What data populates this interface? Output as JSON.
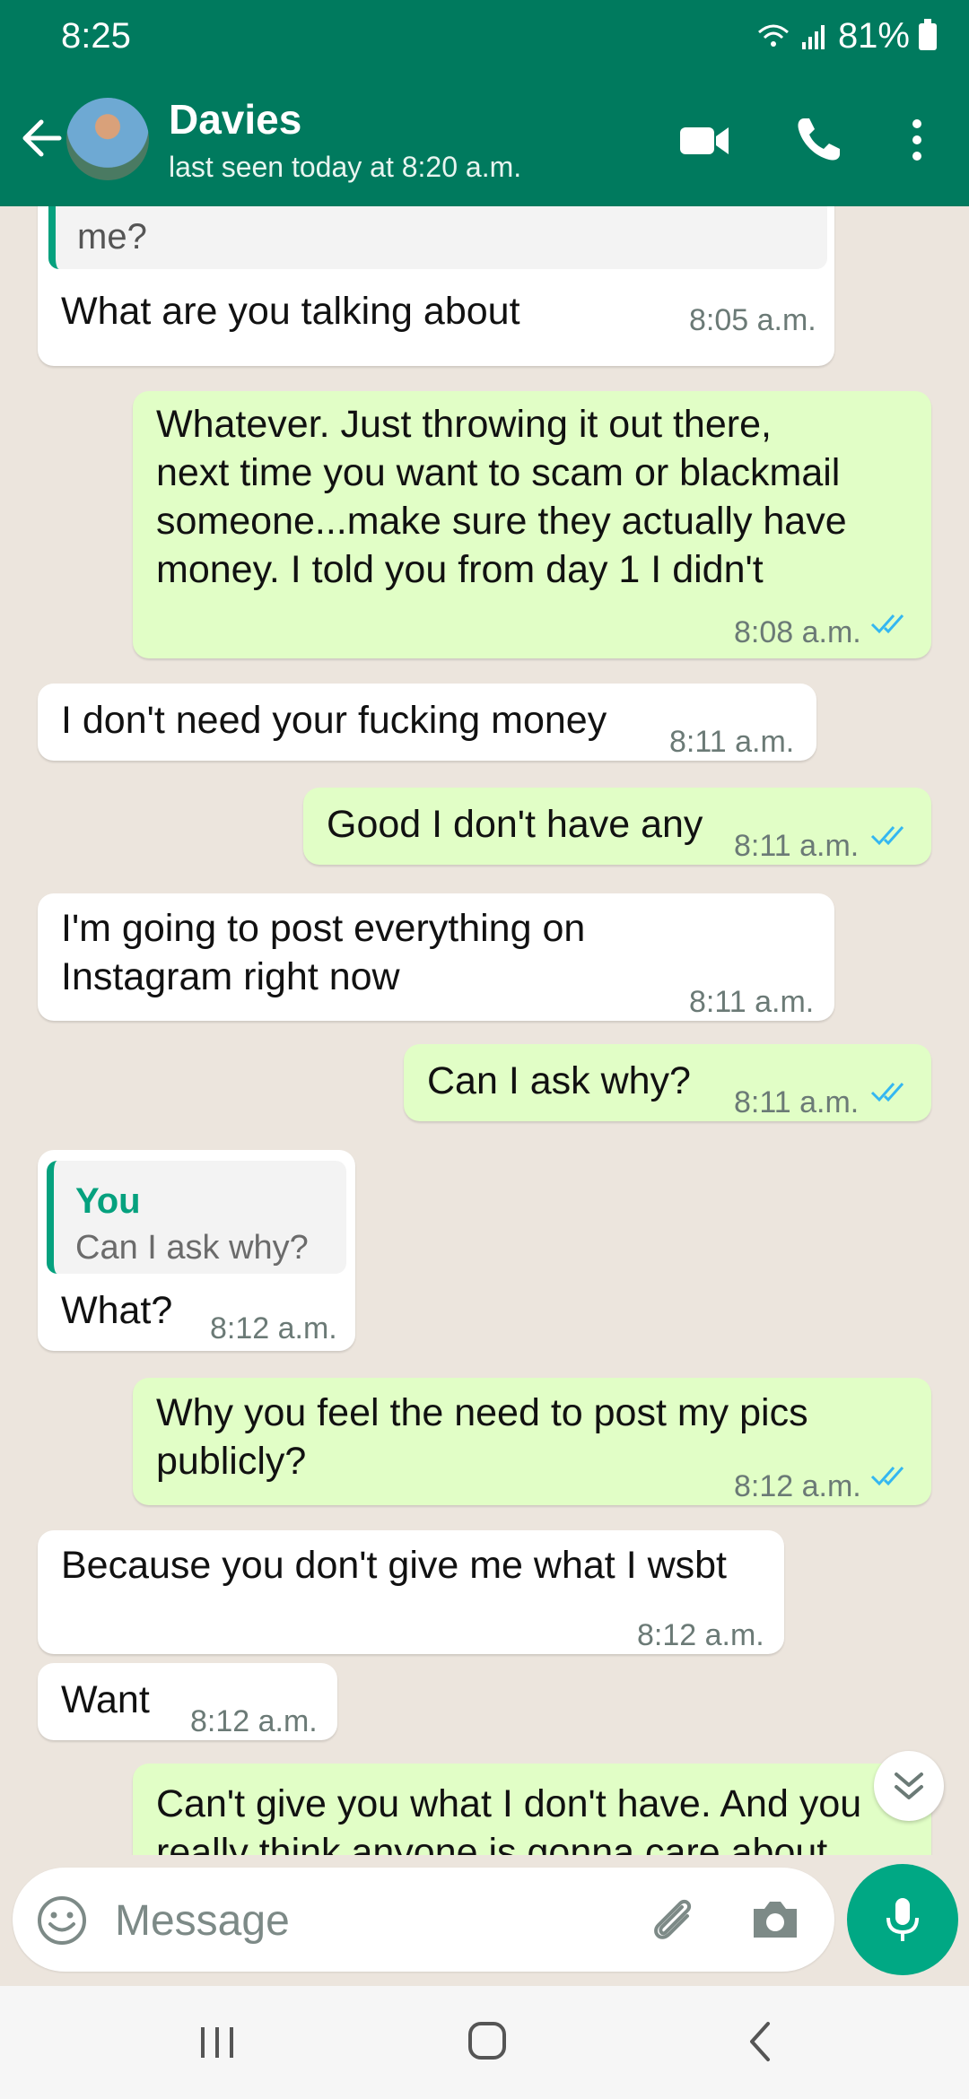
{
  "status_bar": {
    "time": "8:25",
    "battery": "81%"
  },
  "header": {
    "contact_name": "Davies",
    "last_seen": "last seen today at 8:20 a.m."
  },
  "messages": [
    {
      "dir": "in",
      "quote_text": "Wtf? You blackmail me and now want to fuck\nme?",
      "text": "What are you talking about",
      "time": "8:05 a.m."
    },
    {
      "dir": "out",
      "text": "Whatever. Just throwing it out there,\nnext time you want to scam or blackmail\nsomeone...make sure they actually have\nmoney. I told you from day 1 I didn't",
      "time": "8:08 a.m."
    },
    {
      "dir": "in",
      "text": "I don't need your fucking money",
      "time": "8:11 a.m."
    },
    {
      "dir": "out",
      "text": "Good I don't have any",
      "time": "8:11 a.m."
    },
    {
      "dir": "in",
      "text": "I'm going to post everything on\nInstagram right now",
      "time": "8:11 a.m."
    },
    {
      "dir": "out",
      "text": "Can I ask why?",
      "time": "8:11 a.m."
    },
    {
      "dir": "in",
      "quote_author": "You",
      "quote_text": "Can I ask why?",
      "text": "What?",
      "time": "8:12 a.m."
    },
    {
      "dir": "out",
      "text": "Why you feel the need to post my pics\npublicly?",
      "time": "8:12 a.m."
    },
    {
      "dir": "in",
      "text": "Because you don't give me what I wsbt",
      "time": "8:12 a.m."
    },
    {
      "dir": "in",
      "text": "Want",
      "time": "8:12 a.m."
    },
    {
      "dir": "out",
      "text": "Can't give you what I don't have. And you\nreally think anyone is gonna care about",
      "time": ""
    }
  ],
  "input": {
    "placeholder": "Message"
  },
  "icons": {
    "back": "back-arrow-icon",
    "video": "video-call-icon",
    "call": "phone-icon",
    "menu": "more-vert-icon",
    "emoji": "emoji-icon",
    "attach": "paperclip-icon",
    "camera": "camera-icon",
    "mic": "microphone-icon",
    "scroll": "scroll-down-icon",
    "read": "double-check-icon"
  },
  "colors": {
    "header": "#007a5e",
    "outgoing": "#e1fec6",
    "incoming": "#ffffff",
    "accent": "#00a884",
    "read_ticks": "#34b7f1"
  }
}
